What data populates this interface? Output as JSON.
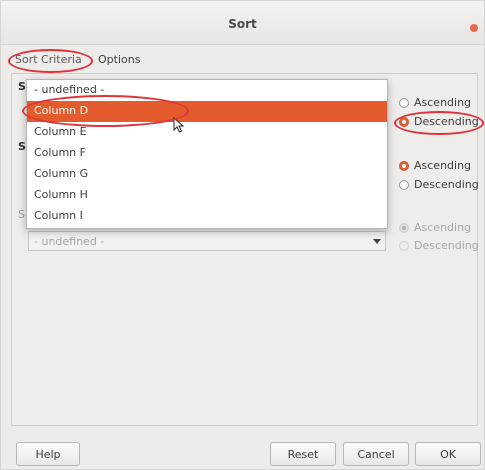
{
  "window": {
    "title": "Sort"
  },
  "tabs": [
    {
      "label": "Sort Criteria"
    },
    {
      "label": "Options"
    }
  ],
  "section_letters": [
    "S",
    "S",
    "S"
  ],
  "dropdown": {
    "items": [
      {
        "label": "- undefined -"
      },
      {
        "label": "Column D",
        "selected": true
      },
      {
        "label": "Column E"
      },
      {
        "label": "Column F"
      },
      {
        "label": "Column G"
      },
      {
        "label": "Column H"
      },
      {
        "label": "Column I"
      }
    ]
  },
  "key3": {
    "value": "- undefined -"
  },
  "key1_order": {
    "ascending": "Ascending",
    "descending": "Descending",
    "selected": "descending"
  },
  "key2_order": {
    "ascending": "Ascending",
    "descending": "Descending",
    "selected": "ascending"
  },
  "key3_order": {
    "ascending": "Ascending",
    "descending": "Descending",
    "selected": "ascending",
    "disabled": true
  },
  "buttons": {
    "help": "Help",
    "reset": "Reset",
    "cancel": "Cancel",
    "ok": "OK"
  },
  "colors": {
    "accent": "#e45c2d",
    "annotation": "#e0323a"
  }
}
